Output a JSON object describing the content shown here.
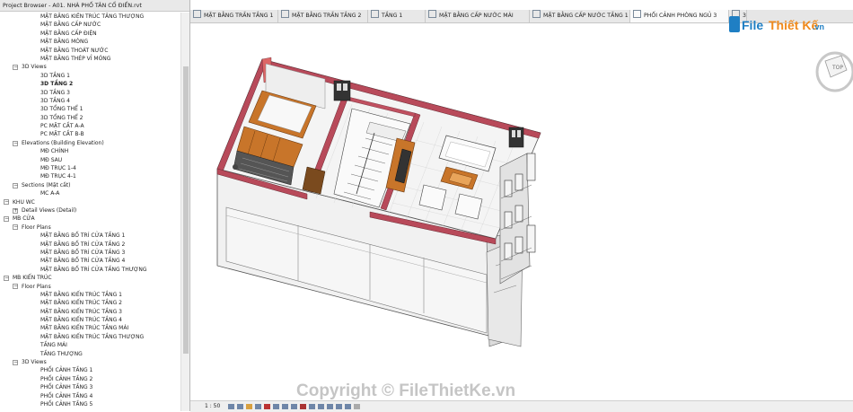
{
  "browser": {
    "title": "Project Browser - A01. NHÀ PHỐ TÂN CỔ ĐIỂN.rvt",
    "rows": [
      {
        "label": "MẶT BẰNG KIẾN TRÚC TẦNG THƯỢNG",
        "level": 3
      },
      {
        "label": "MẶT BẰNG CẤP NƯỚC",
        "level": 3
      },
      {
        "label": "MẶT BẰNG CẤP ĐIỆN",
        "level": 3
      },
      {
        "label": "MẶT BẰNG MÓNG",
        "level": 3
      },
      {
        "label": "MẶT BẰNG THOÁT NƯỚC",
        "level": 3
      },
      {
        "label": "MẶT BẰNG THÉP VỈ MÓNG",
        "level": 3
      },
      {
        "label": "3D Views",
        "level": 2,
        "toggle": "−"
      },
      {
        "label": "3D TẦNG 1",
        "level": 3
      },
      {
        "label": "3D TẦNG 2",
        "level": 3,
        "selected": true
      },
      {
        "label": "3D TẦNG 3",
        "level": 3
      },
      {
        "label": "3D TẦNG 4",
        "level": 3
      },
      {
        "label": "3D TỔNG THỂ 1",
        "level": 3
      },
      {
        "label": "3D TỔNG THỂ 2",
        "level": 3
      },
      {
        "label": "PC MẶT CẮT A-A",
        "level": 3
      },
      {
        "label": "PC MẶT CẮT B-B",
        "level": 3
      },
      {
        "label": "Elevations (Building Elevation)",
        "level": 2,
        "toggle": "−"
      },
      {
        "label": "MĐ CHÍNH",
        "level": 3
      },
      {
        "label": "MĐ SAU",
        "level": 3
      },
      {
        "label": "MĐ TRỤC 1-4",
        "level": 3
      },
      {
        "label": "MĐ TRỤC 4-1",
        "level": 3
      },
      {
        "label": "Sections (Mặt cắt)",
        "level": 2,
        "toggle": "−"
      },
      {
        "label": "MC A-A",
        "level": 3
      },
      {
        "label": "KHU WC",
        "level": 1,
        "toggle": "−"
      },
      {
        "label": "Detail Views (Detail)",
        "level": 2,
        "toggle": "+"
      },
      {
        "label": "MB CỬA",
        "level": 1,
        "toggle": "−"
      },
      {
        "label": "Floor Plans",
        "level": 2,
        "toggle": "−"
      },
      {
        "label": "MẶT BẰNG BỐ TRÍ CỬA TẦNG 1",
        "level": 3
      },
      {
        "label": "MẶT BẰNG BỐ TRÍ CỬA TẦNG 2",
        "level": 3
      },
      {
        "label": "MẶT BẰNG BỐ TRÍ CỬA TẦNG 3",
        "level": 3
      },
      {
        "label": "MẶT BẰNG BỐ TRÍ CỬA TẦNG 4",
        "level": 3
      },
      {
        "label": "MẶT BẰNG BỐ TRÍ CỬA TẦNG THƯỢNG",
        "level": 3
      },
      {
        "label": "MB KIẾN TRÚC",
        "level": 1,
        "toggle": "−"
      },
      {
        "label": "Floor Plans",
        "level": 2,
        "toggle": "−"
      },
      {
        "label": "MẶT BẰNG KIẾN TRÚC TẦNG 1",
        "level": 3
      },
      {
        "label": "MẶT BẰNG KIẾN TRÚC TẦNG 2",
        "level": 3
      },
      {
        "label": "MẶT BẰNG KIẾN TRÚC TẦNG 3",
        "level": 3
      },
      {
        "label": "MẶT BẰNG KIẾN TRÚC TẦNG 4",
        "level": 3
      },
      {
        "label": "MẶT BẰNG KIẾN TRÚC TẦNG MÁI",
        "level": 3
      },
      {
        "label": "MẶT BẰNG KIẾN TRÚC TẦNG THƯỢNG",
        "level": 3
      },
      {
        "label": "TẦNG MÁI",
        "level": 3
      },
      {
        "label": "TẦNG THƯỢNG",
        "level": 3
      },
      {
        "label": "3D Views",
        "level": 2,
        "toggle": "−"
      },
      {
        "label": "PHỐI CẢNH TẦNG 1",
        "level": 3
      },
      {
        "label": "PHỐI CẢNH TẦNG 2",
        "level": 3
      },
      {
        "label": "PHỐI CẢNH TẦNG 3",
        "level": 3
      },
      {
        "label": "PHỐI CẢNH TẦNG 4",
        "level": 3
      },
      {
        "label": "PHỐI CẢNH TẦNG 5",
        "level": 3
      }
    ]
  },
  "tabs": [
    {
      "label": "MẶT BẰNG TRẦN TẦNG 1",
      "icon": "floor-plan-icon"
    },
    {
      "label": "MẶT BẰNG TRẦN TẦNG 2",
      "icon": "floor-plan-icon"
    },
    {
      "label": "TẦNG 1",
      "icon": "floor-plan-icon"
    },
    {
      "label": "MẶT BẰNG CẤP NƯỚC MÁI",
      "icon": "floor-plan-icon"
    },
    {
      "label": "MẶT BẰNG CẤP NƯỚC TẦNG 1",
      "icon": "floor-plan-icon"
    },
    {
      "label": "PHỐI CẢNH PHÒNG NGỦ 3",
      "icon": "3d-view-icon"
    },
    {
      "label": "3",
      "icon": "3d-view-icon"
    }
  ],
  "status": {
    "scale": "1 : 50"
  },
  "logo": {
    "brand_a": "File",
    "brand_b": "Thiết Kế",
    ".vn": ".vn"
  },
  "watermark": "Copyright © FileThietKe.vn",
  "viewcube": {
    "face": "TOP"
  },
  "colors": {
    "wall_top": "#b84a5a",
    "wood": "#c8752a",
    "accent_blue": "#1f7fc4",
    "logo_orange": "#f08a1c"
  }
}
